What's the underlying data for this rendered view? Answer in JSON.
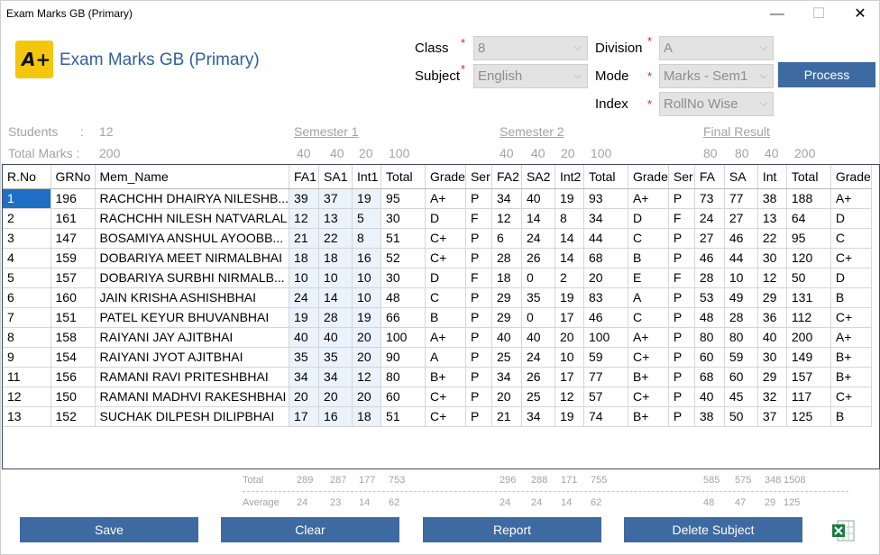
{
  "window": {
    "title": "Exam Marks GB (Primary)",
    "min": "—",
    "max": "☐",
    "close": "✕"
  },
  "header": {
    "logo_text": "A+",
    "app_title": "Exam Marks GB (Primary)"
  },
  "form": {
    "class_label": "Class",
    "class_value": "8",
    "subject_label": "Subject",
    "subject_value": "English",
    "division_label": "Division",
    "division_value": "A",
    "mode_label": "Mode",
    "mode_value": "Marks - Sem1",
    "index_label": "Index",
    "index_value": "RollNo Wise",
    "required_mark": "*",
    "process_label": "Process",
    "chevron": "⌵"
  },
  "summary": {
    "students_label": "Students",
    "students_sep": ":",
    "students_value": "12",
    "total_marks_label": "Total Marks :",
    "total_marks_value": "200",
    "sem1_title": "Semester 1",
    "sem2_title": "Semester 2",
    "final_title": "Final Result",
    "sem1_max": [
      "40",
      "40",
      "20",
      "100"
    ],
    "sem2_max": [
      "40",
      "40",
      "20",
      "100"
    ],
    "final_max": [
      "80",
      "80",
      "40",
      "200"
    ]
  },
  "table": {
    "columns": [
      "R.No",
      "GRNo",
      "Mem_Name",
      "FA1",
      "SA1",
      "Int1",
      "Total",
      "Grade",
      "Ser",
      "FA2",
      "SA2",
      "Int2",
      "Total",
      "Grade",
      "Ser",
      "FA",
      "SA",
      "Int",
      "Total",
      "Grade"
    ],
    "rows": [
      [
        "1",
        "196",
        "RACHCHH DHAIRYA NILESHB...",
        "39",
        "37",
        "19",
        "95",
        "A+",
        "P",
        "34",
        "40",
        "19",
        "93",
        "A+",
        "P",
        "73",
        "77",
        "38",
        "188",
        "A+"
      ],
      [
        "2",
        "161",
        "RACHCHH NILESH NATVARLAL",
        "12",
        "13",
        "5",
        "30",
        "D",
        "F",
        "12",
        "14",
        "8",
        "34",
        "D",
        "F",
        "24",
        "27",
        "13",
        "64",
        "D"
      ],
      [
        "3",
        "147",
        "BOSAMIYA ANSHUL AYOOBB...",
        "21",
        "22",
        "8",
        "51",
        "C+",
        "P",
        "6",
        "24",
        "14",
        "44",
        "C",
        "P",
        "27",
        "46",
        "22",
        "95",
        "C"
      ],
      [
        "4",
        "159",
        "DOBARIYA MEET NIRMALBHAI",
        "18",
        "18",
        "16",
        "52",
        "C+",
        "P",
        "28",
        "26",
        "14",
        "68",
        "B",
        "P",
        "46",
        "44",
        "30",
        "120",
        "C+"
      ],
      [
        "5",
        "157",
        "DOBARIYA SURBHI NIRMALB...",
        "10",
        "10",
        "10",
        "30",
        "D",
        "F",
        "18",
        "0",
        "2",
        "20",
        "E",
        "F",
        "28",
        "10",
        "12",
        "50",
        "D"
      ],
      [
        "6",
        "160",
        "JAIN KRISHA ASHISHBHAI",
        "24",
        "14",
        "10",
        "48",
        "C",
        "P",
        "29",
        "35",
        "19",
        "83",
        "A",
        "P",
        "53",
        "49",
        "29",
        "131",
        "B"
      ],
      [
        "7",
        "151",
        "PATEL KEYUR BHUVANBHAI",
        "19",
        "28",
        "19",
        "66",
        "B",
        "P",
        "29",
        "0",
        "17",
        "46",
        "C",
        "P",
        "48",
        "28",
        "36",
        "112",
        "C+"
      ],
      [
        "8",
        "158",
        "RAIYANI JAY AJITBHAI",
        "40",
        "40",
        "20",
        "100",
        "A+",
        "P",
        "40",
        "40",
        "20",
        "100",
        "A+",
        "P",
        "80",
        "80",
        "40",
        "200",
        "A+"
      ],
      [
        "9",
        "154",
        "RAIYANI JYOT AJITBHAI",
        "35",
        "35",
        "20",
        "90",
        "A",
        "P",
        "25",
        "24",
        "10",
        "59",
        "C+",
        "P",
        "60",
        "59",
        "30",
        "149",
        "B+"
      ],
      [
        "11",
        "156",
        "RAMANI RAVI PRITESHBHAI",
        "34",
        "34",
        "12",
        "80",
        "B+",
        "P",
        "34",
        "26",
        "17",
        "77",
        "B+",
        "P",
        "68",
        "60",
        "29",
        "157",
        "B+"
      ],
      [
        "12",
        "150",
        "RAMANI MADHVI RAKESHBHAI",
        "20",
        "20",
        "20",
        "60",
        "C+",
        "P",
        "20",
        "25",
        "12",
        "57",
        "C+",
        "P",
        "40",
        "45",
        "32",
        "117",
        "C+"
      ],
      [
        "13",
        "152",
        "SUCHAK DILPESH DILIPBHAI",
        "17",
        "16",
        "18",
        "51",
        "C+",
        "P",
        "21",
        "34",
        "19",
        "74",
        "B+",
        "P",
        "38",
        "50",
        "37",
        "125",
        "B"
      ]
    ]
  },
  "footer": {
    "total_label": "Total",
    "average_label": "Average",
    "sem1_totals": [
      "289",
      "287",
      "177",
      "753"
    ],
    "sem2_totals": [
      "296",
      "288",
      "171",
      "755"
    ],
    "final_totals": [
      "585",
      "575",
      "348",
      "1508"
    ],
    "sem1_avgs": [
      "24",
      "23",
      "14",
      "62"
    ],
    "sem2_avgs": [
      "24",
      "24",
      "14",
      "62"
    ],
    "final_avgs": [
      "48",
      "47",
      "29",
      "125"
    ]
  },
  "buttons": {
    "save": "Save",
    "clear": "Clear",
    "report": "Report",
    "delete_subject": "Delete Subject"
  },
  "colors": {
    "button_blue": "#3d6aa1",
    "selection_blue": "#1f6fc4",
    "title_blue": "#2e5f9e",
    "logo_yellow": "#f4c70e",
    "required_red": "#e02020"
  },
  "icons": {
    "excel": "excel-export-icon"
  }
}
